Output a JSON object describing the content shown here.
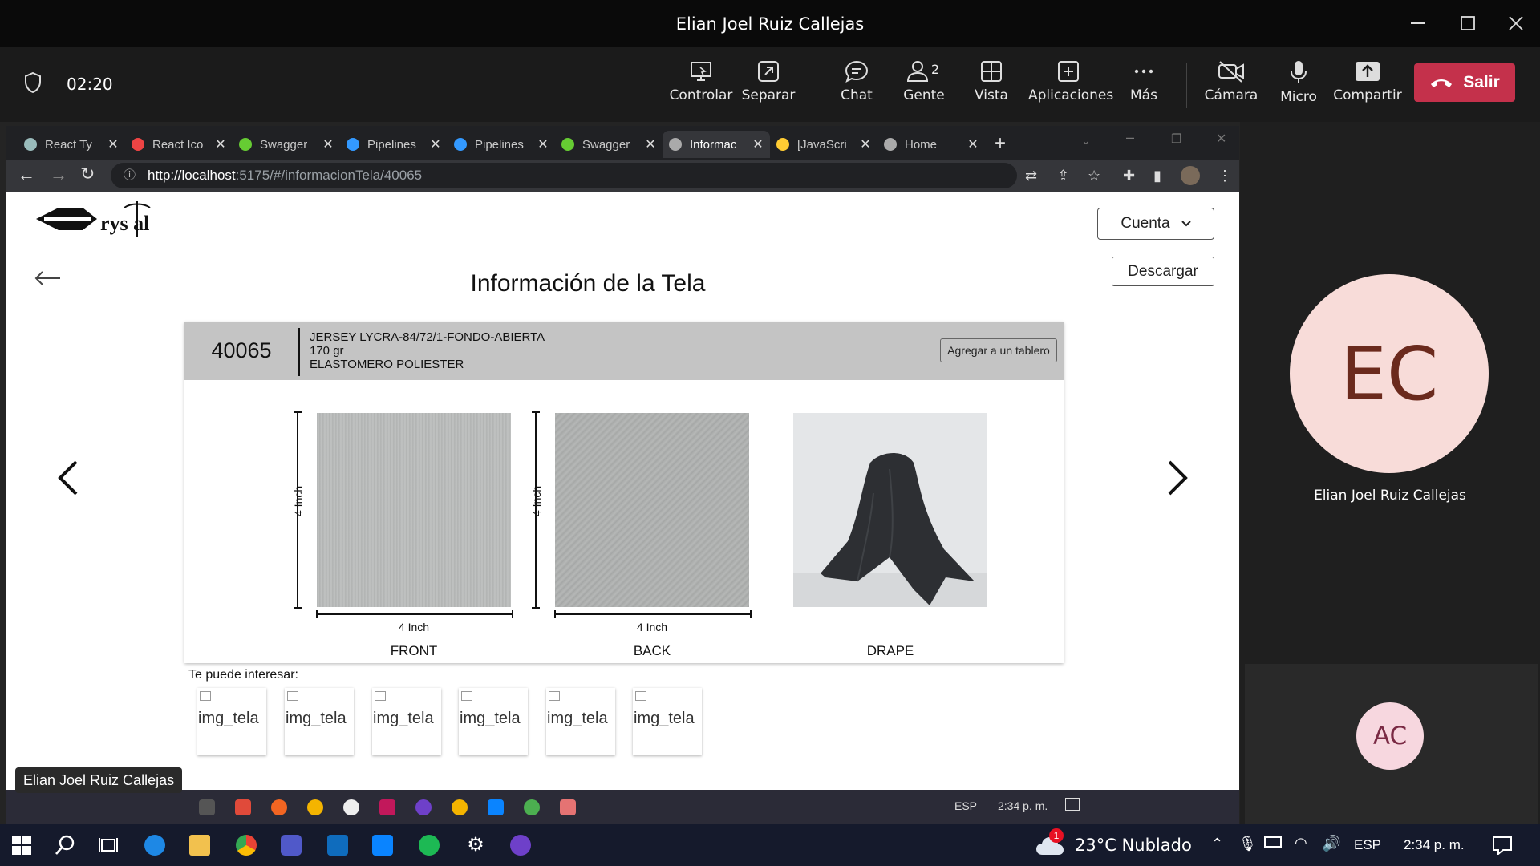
{
  "meeting": {
    "window_title": "Elian Joel Ruiz Callejas",
    "timer": "02:20",
    "tools": [
      {
        "label": "Controlar",
        "icon": "control-icon"
      },
      {
        "label": "Separar",
        "icon": "popout-icon"
      },
      {
        "label": "Chat",
        "icon": "chat-icon"
      },
      {
        "label": "Gente",
        "icon": "people-icon",
        "badge": "2"
      },
      {
        "label": "Vista",
        "icon": "view-icon"
      },
      {
        "label": "Aplicaciones",
        "icon": "apps-icon"
      },
      {
        "label": "Más",
        "icon": "more-icon"
      },
      {
        "label": "Cámara",
        "icon": "camera-off-icon"
      },
      {
        "label": "Micro",
        "icon": "mic-icon"
      },
      {
        "label": "Compartir",
        "icon": "share-icon"
      }
    ],
    "leave_label": "Salir",
    "leave_color": "#c4314b"
  },
  "browser": {
    "tabs": [
      {
        "label": "React Ty",
        "favicon": "openai-icon",
        "color": "#9bb"
      },
      {
        "label": "React Ico",
        "favicon": "react-icon",
        "color": "#e44"
      },
      {
        "label": "Swagger",
        "favicon": "swagger-icon",
        "color": "#6c3"
      },
      {
        "label": "Pipelines",
        "favicon": "azure-icon",
        "color": "#39f"
      },
      {
        "label": "Pipelines",
        "favicon": "azure-icon",
        "color": "#39f"
      },
      {
        "label": "Swagger",
        "favicon": "swagger-icon",
        "color": "#6c3"
      },
      {
        "label": "Informac",
        "favicon": "crystal-icon",
        "color": "#aaa",
        "active": true
      },
      {
        "label": "[JavaScri",
        "favicon": "js-icon",
        "color": "#fc3"
      },
      {
        "label": "Home",
        "favicon": "crystal-icon",
        "color": "#aaa"
      }
    ],
    "url_host": "http://localhost",
    "url_rest": ":5175/#/informacionTela/40065"
  },
  "app": {
    "logo_text": "rys al",
    "account_label": "Cuenta",
    "download_label": "Descargar",
    "page_title": "Información de la Tela",
    "fabric": {
      "code": "40065",
      "name": "JERSEY LYCRA-84/72/1-FONDO-ABIERTA",
      "weight": "170 gr",
      "composition": "ELASTOMERO POLIESTER",
      "add_board_label": "Agregar a un tablero"
    },
    "images": [
      {
        "label": "FRONT",
        "height_dim": "4 Inch",
        "width_dim": "4 Inch"
      },
      {
        "label": "BACK",
        "height_dim": "4 Inch",
        "width_dim": "4 Inch"
      },
      {
        "label": "DRAPE"
      }
    ],
    "suggest_label": "Te puede interesar:",
    "suggestions": [
      "img_tela",
      "img_tela",
      "img_tela",
      "img_tela",
      "img_tela",
      "img_tela"
    ],
    "inner_taskbar": {
      "lang": "ESP",
      "time": "2:34 p. m."
    }
  },
  "presenter_tag": "Elian Joel Ruiz Callejas",
  "participants": [
    {
      "initials": "EC",
      "name": "Elian Joel Ruiz Callejas"
    },
    {
      "initials": "AC"
    }
  ],
  "taskbar": {
    "weather_badge": "1",
    "weather": "23°C  Nublado",
    "lang": "ESP",
    "time": "2:34 p. m."
  }
}
